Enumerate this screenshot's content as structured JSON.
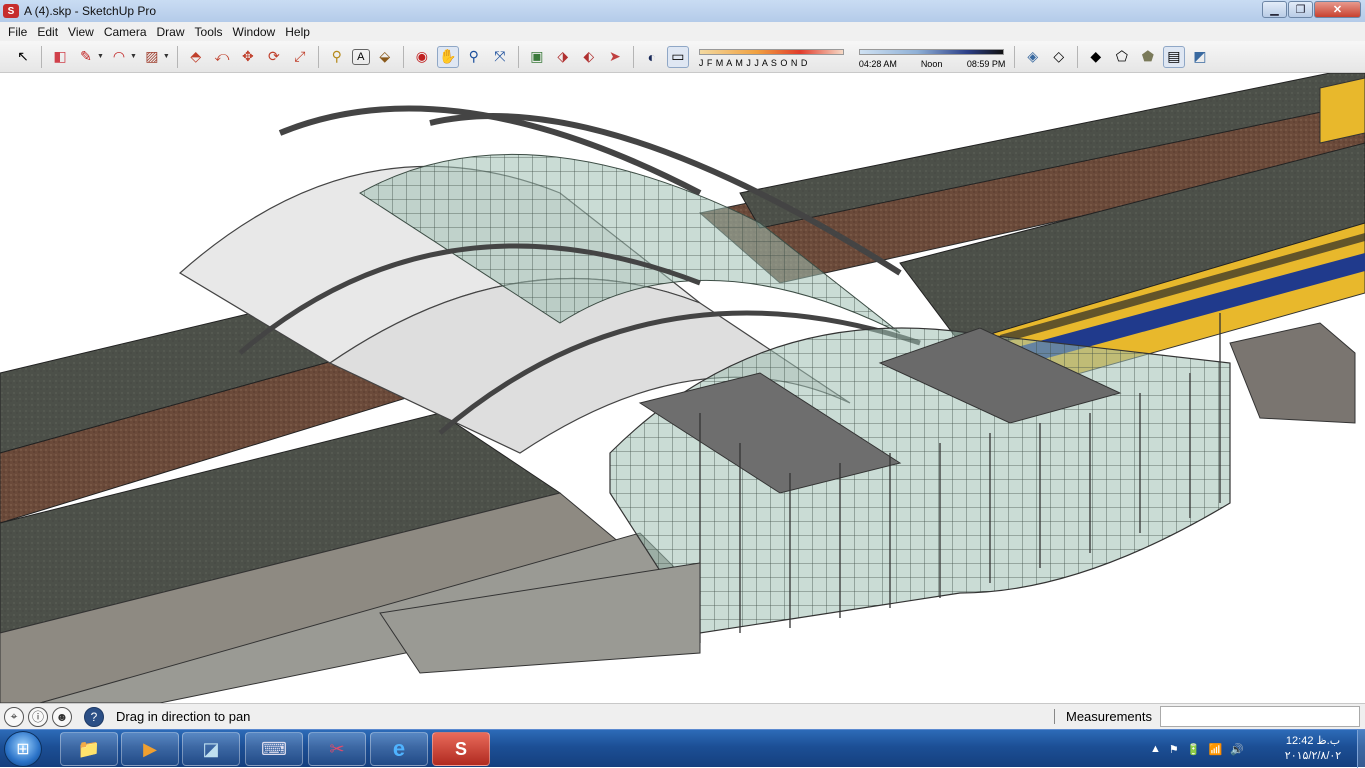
{
  "window": {
    "title": "A (4).skp - SketchUp Pro",
    "app_icon": "sketchup-icon"
  },
  "menubar": {
    "items": [
      "File",
      "Edit",
      "View",
      "Camera",
      "Draw",
      "Tools",
      "Window",
      "Help"
    ]
  },
  "toolbar": {
    "tools": [
      {
        "name": "select-tool",
        "glyph": "↖"
      },
      {
        "name": "eraser-tool",
        "glyph": "◧"
      },
      {
        "name": "pencil-line-tool",
        "glyph": "✎"
      },
      {
        "name": "arc-tool",
        "glyph": "◠"
      },
      {
        "name": "rectangle-tool",
        "glyph": "▨"
      },
      {
        "name": "push-pull-tool",
        "glyph": "⬘"
      },
      {
        "name": "follow-me-tool",
        "glyph": "⤺"
      },
      {
        "name": "move-tool",
        "glyph": "✥"
      },
      {
        "name": "rotate-tool",
        "glyph": "⟳"
      },
      {
        "name": "scale-tool",
        "glyph": "⤢"
      },
      {
        "name": "tape-measure-tool",
        "glyph": "⚲"
      },
      {
        "name": "text-tool",
        "glyph": "A"
      },
      {
        "name": "paint-bucket-tool",
        "glyph": "⬙"
      },
      {
        "name": "orbit-tool",
        "glyph": "◉"
      },
      {
        "name": "pan-tool",
        "glyph": "✋"
      },
      {
        "name": "zoom-tool",
        "glyph": "⚲"
      },
      {
        "name": "zoom-extents-tool",
        "glyph": "⤧"
      },
      {
        "name": "warehouse-tool",
        "glyph": "▣"
      },
      {
        "name": "share-model-tool",
        "glyph": "⬗"
      },
      {
        "name": "extension-warehouse-tool",
        "glyph": "⬖"
      },
      {
        "name": "send-to-layout-tool",
        "glyph": "➤"
      },
      {
        "name": "shadows-toggle",
        "glyph": "◐"
      },
      {
        "name": "fog-toggle",
        "glyph": "▭"
      }
    ],
    "months_label": "J F M A M J J A S O N D",
    "time_start": "04:28 AM",
    "time_noon": "Noon",
    "time_end": "08:59 PM",
    "styles": [
      {
        "name": "xray-style",
        "glyph": "◈"
      },
      {
        "name": "wireframe-style",
        "glyph": "◇"
      },
      {
        "name": "hidden-line-style",
        "glyph": "◆"
      },
      {
        "name": "shaded-style",
        "glyph": "⬠"
      },
      {
        "name": "shaded-texture-style",
        "glyph": "⬟"
      },
      {
        "name": "monochrome-style",
        "glyph": "▤"
      },
      {
        "name": "back-edges-style",
        "glyph": "◩"
      }
    ]
  },
  "statusbar": {
    "icons": [
      "geo-location-icon",
      "credits-icon",
      "user-icon"
    ],
    "help_icon": "?",
    "status_text": "Drag in direction to pan",
    "measurements_label": "Measurements",
    "measurements_value": ""
  },
  "taskbar": {
    "start_glyph": "⊞",
    "apps": [
      {
        "name": "explorer-icon",
        "glyph": "📁"
      },
      {
        "name": "media-player-icon",
        "glyph": "▶"
      },
      {
        "name": "notes-icon",
        "glyph": "◪"
      },
      {
        "name": "keyboard-icon",
        "glyph": "⌨"
      },
      {
        "name": "paint-icon",
        "glyph": "✂"
      },
      {
        "name": "ie-icon",
        "glyph": "e"
      },
      {
        "name": "sketchup-icon",
        "glyph": "S"
      }
    ],
    "tray": [
      "▲",
      "⚑",
      "🔋",
      "📶",
      "🔊"
    ],
    "time": "12:42 ب.ظ",
    "date": "۲۰۱۵/۲/۸/۰۲"
  },
  "colors": {
    "platform_roof": "#4c5049",
    "track_ballast": "#6b4a3a",
    "roof_membrane": "#e8e8e8",
    "glass": "#7fa596",
    "train_body": "#e8b82c",
    "train_stripe": "#203a8c"
  }
}
